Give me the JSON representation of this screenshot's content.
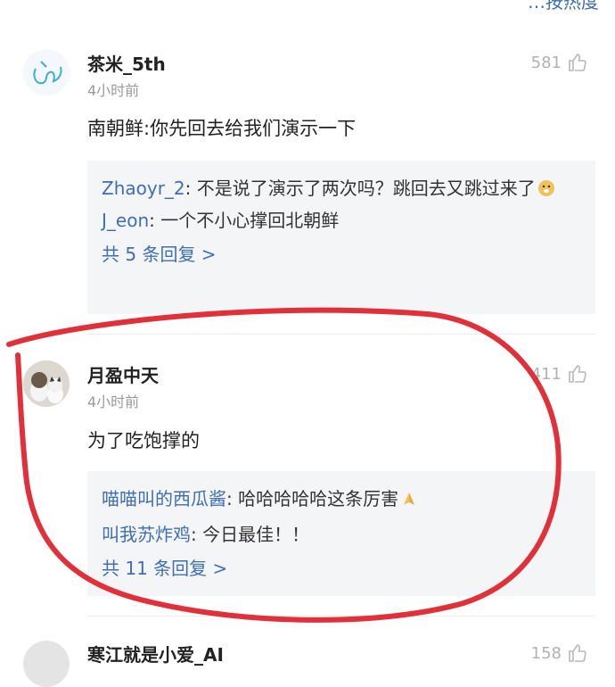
{
  "top_fragment": "…按热度",
  "comments": [
    {
      "user": "茶米_5th",
      "time": "4小时前",
      "likes": "581",
      "text": "南朝鲜:你先回去给我们演示一下",
      "replies": [
        {
          "name": "Zhaoyr_2",
          "sep": ": ",
          "text": "不是说了演示了两次吗？跳回去又跳过来了"
        },
        {
          "name": "J_eon",
          "sep": ": ",
          "text": "一个不小心撑回北朝鲜"
        }
      ],
      "more": "共 5 条回复 >"
    },
    {
      "user": "月盈中天",
      "time": "4小时前",
      "likes": "411",
      "text": "为了吃饱撑的",
      "replies": [
        {
          "name": "喵喵叫的西瓜酱",
          "sep": ": ",
          "text": "哈哈哈哈哈这条厉害"
        },
        {
          "name": "叫我苏炸鸡",
          "sep": ": ",
          "text": "今日最佳！！"
        }
      ],
      "more": "共 11 条回复 >"
    },
    {
      "user": "寒江就是小爱_AI",
      "likes": "158"
    }
  ],
  "colors": {
    "link": "#3f6fb0",
    "annotation": "#e0313a",
    "reply_bg": "#f4f5f7"
  }
}
